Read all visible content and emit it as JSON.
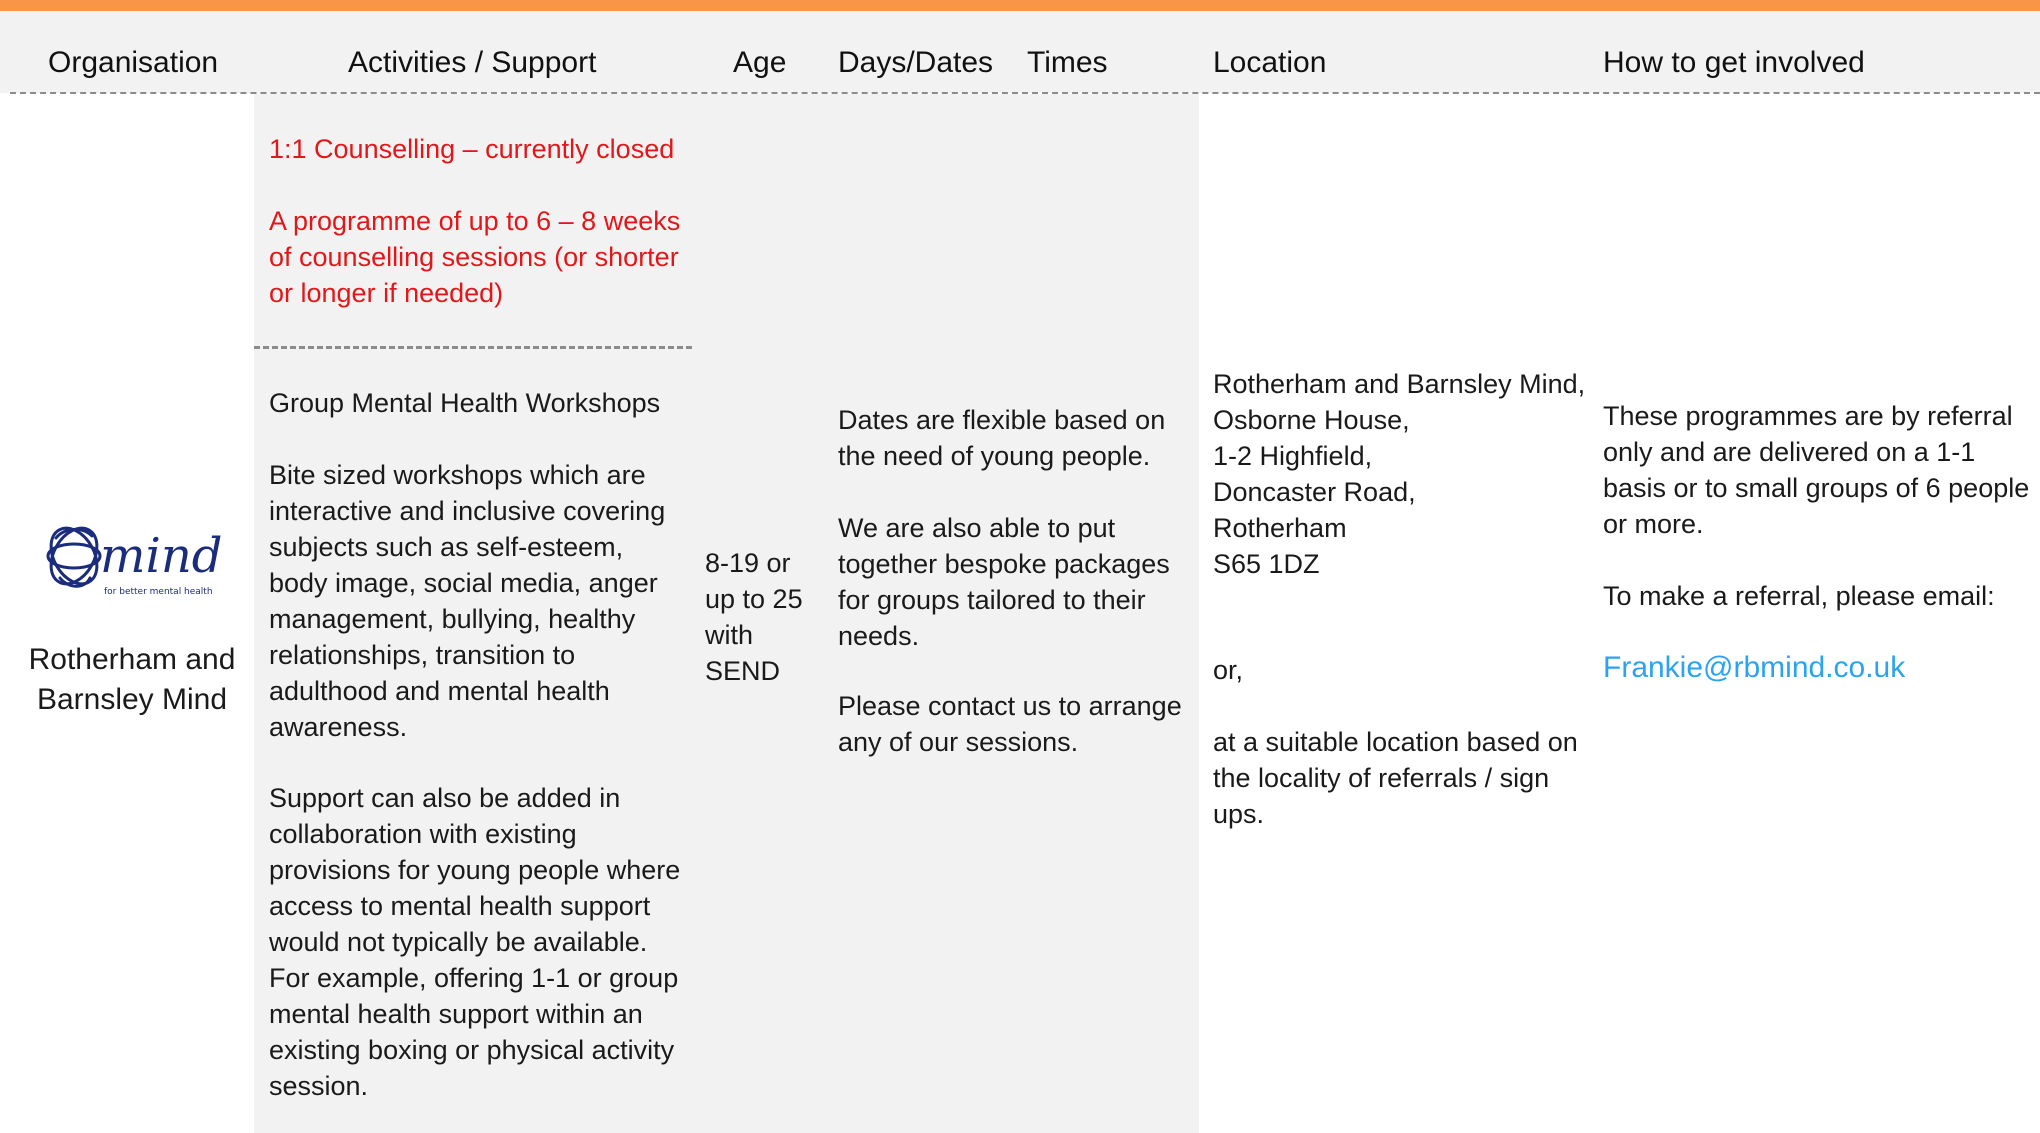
{
  "header": {
    "organisation": "Organisation",
    "activities": "Activities / Support",
    "age": "Age",
    "days": "Days/Dates",
    "times": "Times",
    "location": "Location",
    "involved": "How to get involved"
  },
  "row": {
    "organisation_name": "Rotherham and Barnsley Mind",
    "logo": {
      "icon": "mind-logo-icon",
      "wordmark": "mind",
      "tagline": "for better mental health",
      "color": "#1c2c7d"
    },
    "activity1": {
      "title": "1:1 Counselling – currently closed",
      "description": "A programme of up to 6 – 8 weeks of counselling sessions (or shorter or longer if needed)",
      "color": "#e0181b"
    },
    "activity2": {
      "title": "Group Mental Health Workshops",
      "description": "Bite sized workshops which are interactive and inclusive covering subjects such as self-esteem, body image, social media, anger management, bullying, healthy relationships, transition to adulthood and mental health awareness.",
      "description2": "Support can also be added in collaboration with existing provisions for young people where access to mental health support would not typically be available. For example, offering 1-1 or group mental health support within an existing boxing or physical activity session."
    },
    "age": "8-19 or up to 25 with SEND",
    "dates": [
      "Dates are flexible based on the need of young people.",
      " We are also able to put together bespoke packages for groups tailored to their needs.",
      "Please contact us to arrange any of our sessions."
    ],
    "location": {
      "address": "Rotherham and Barnsley Mind,\nOsborne House,\n1-2 Highfield,\nDoncaster Road,\nRotherham\nS65 1DZ",
      "or": "or,",
      "alternative": "at a suitable location based on the locality of referrals / sign ups."
    },
    "involved": {
      "text": "These programmes are by referral only and are delivered on a 1-1 basis or to small groups of 6 people or more.",
      "prompt": "To make a referral, please email:",
      "email": "Frankie@rbmind.co.uk",
      "link_color": "#2aa3f0"
    }
  }
}
